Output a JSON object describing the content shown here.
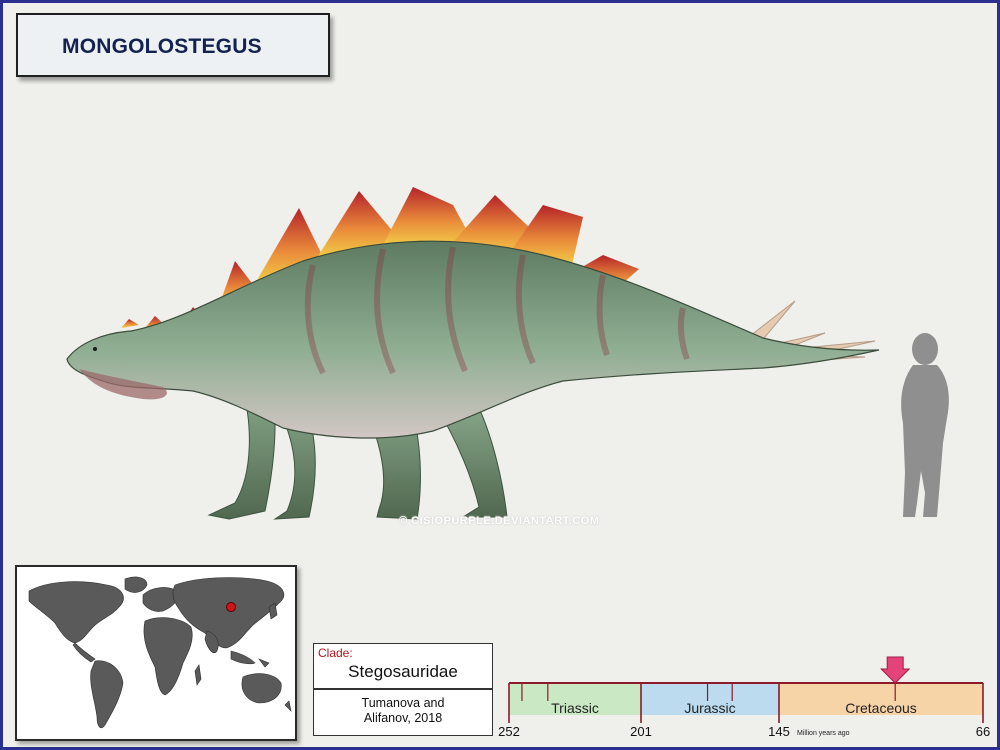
{
  "title": "MONGOLOSTEGUS",
  "watermark": "© CISIOPURPLE.DEVIANTART.COM",
  "clade": {
    "label": "Clade:",
    "name": "Stegosauridae",
    "author_line1": "Tumanova and",
    "author_line2": "Alifanov, 2018"
  },
  "timeline": {
    "periods": [
      {
        "name": "Triassic",
        "start": 252,
        "end": 201,
        "color": "#c9e8c3"
      },
      {
        "name": "Jurassic",
        "start": 201,
        "end": 145,
        "color": "#bcdbee"
      },
      {
        "name": "Cretaceous",
        "start": 145,
        "end": 66,
        "color": "#f7d3a8"
      }
    ],
    "tick_labels": [
      "252",
      "201",
      "145",
      "66"
    ],
    "unit_label": "Million years ago",
    "marker_mya": 100,
    "marker_color": "#e4437a",
    "line_color": "#8a1a2c"
  },
  "map": {
    "locality_region": "Mongolia",
    "marker_color": "#d0141a"
  },
  "colors": {
    "title_text": "#14224f",
    "page_border": "#2b2f8f",
    "background": "#efefeb"
  }
}
